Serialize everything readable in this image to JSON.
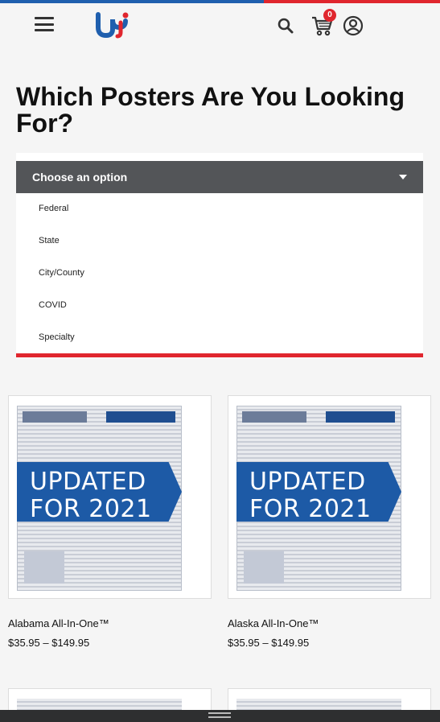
{
  "header": {
    "menu_icon": "hamburger-menu-icon",
    "logo_icon": "brand-logo",
    "search_icon": "search-icon",
    "cart_icon": "cart-icon",
    "cart_count": "0",
    "account_icon": "account-icon",
    "stripe_colors": [
      "#1f5fae",
      "#e0262e"
    ]
  },
  "main": {
    "title": "Which Posters Are You Looking For?",
    "dropdown": {
      "selected_label": "Choose an option",
      "options": [
        "Federal",
        "State",
        "City/County",
        "COVID",
        "Specialty"
      ]
    }
  },
  "products": [
    {
      "name": "Alabama All-In-One™",
      "price": "$35.95 – $149.95",
      "badge_line1": "UPDATED",
      "badge_line2": "FOR 2021"
    },
    {
      "name": "Alaska All-In-One™",
      "price": "$35.95 – $149.95",
      "badge_line1": "UPDATED",
      "badge_line2": "FOR 2021"
    }
  ],
  "colors": {
    "accent_red": "#e0262e",
    "brand_blue": "#1d5aa6",
    "dropdown_bg": "#535558"
  }
}
